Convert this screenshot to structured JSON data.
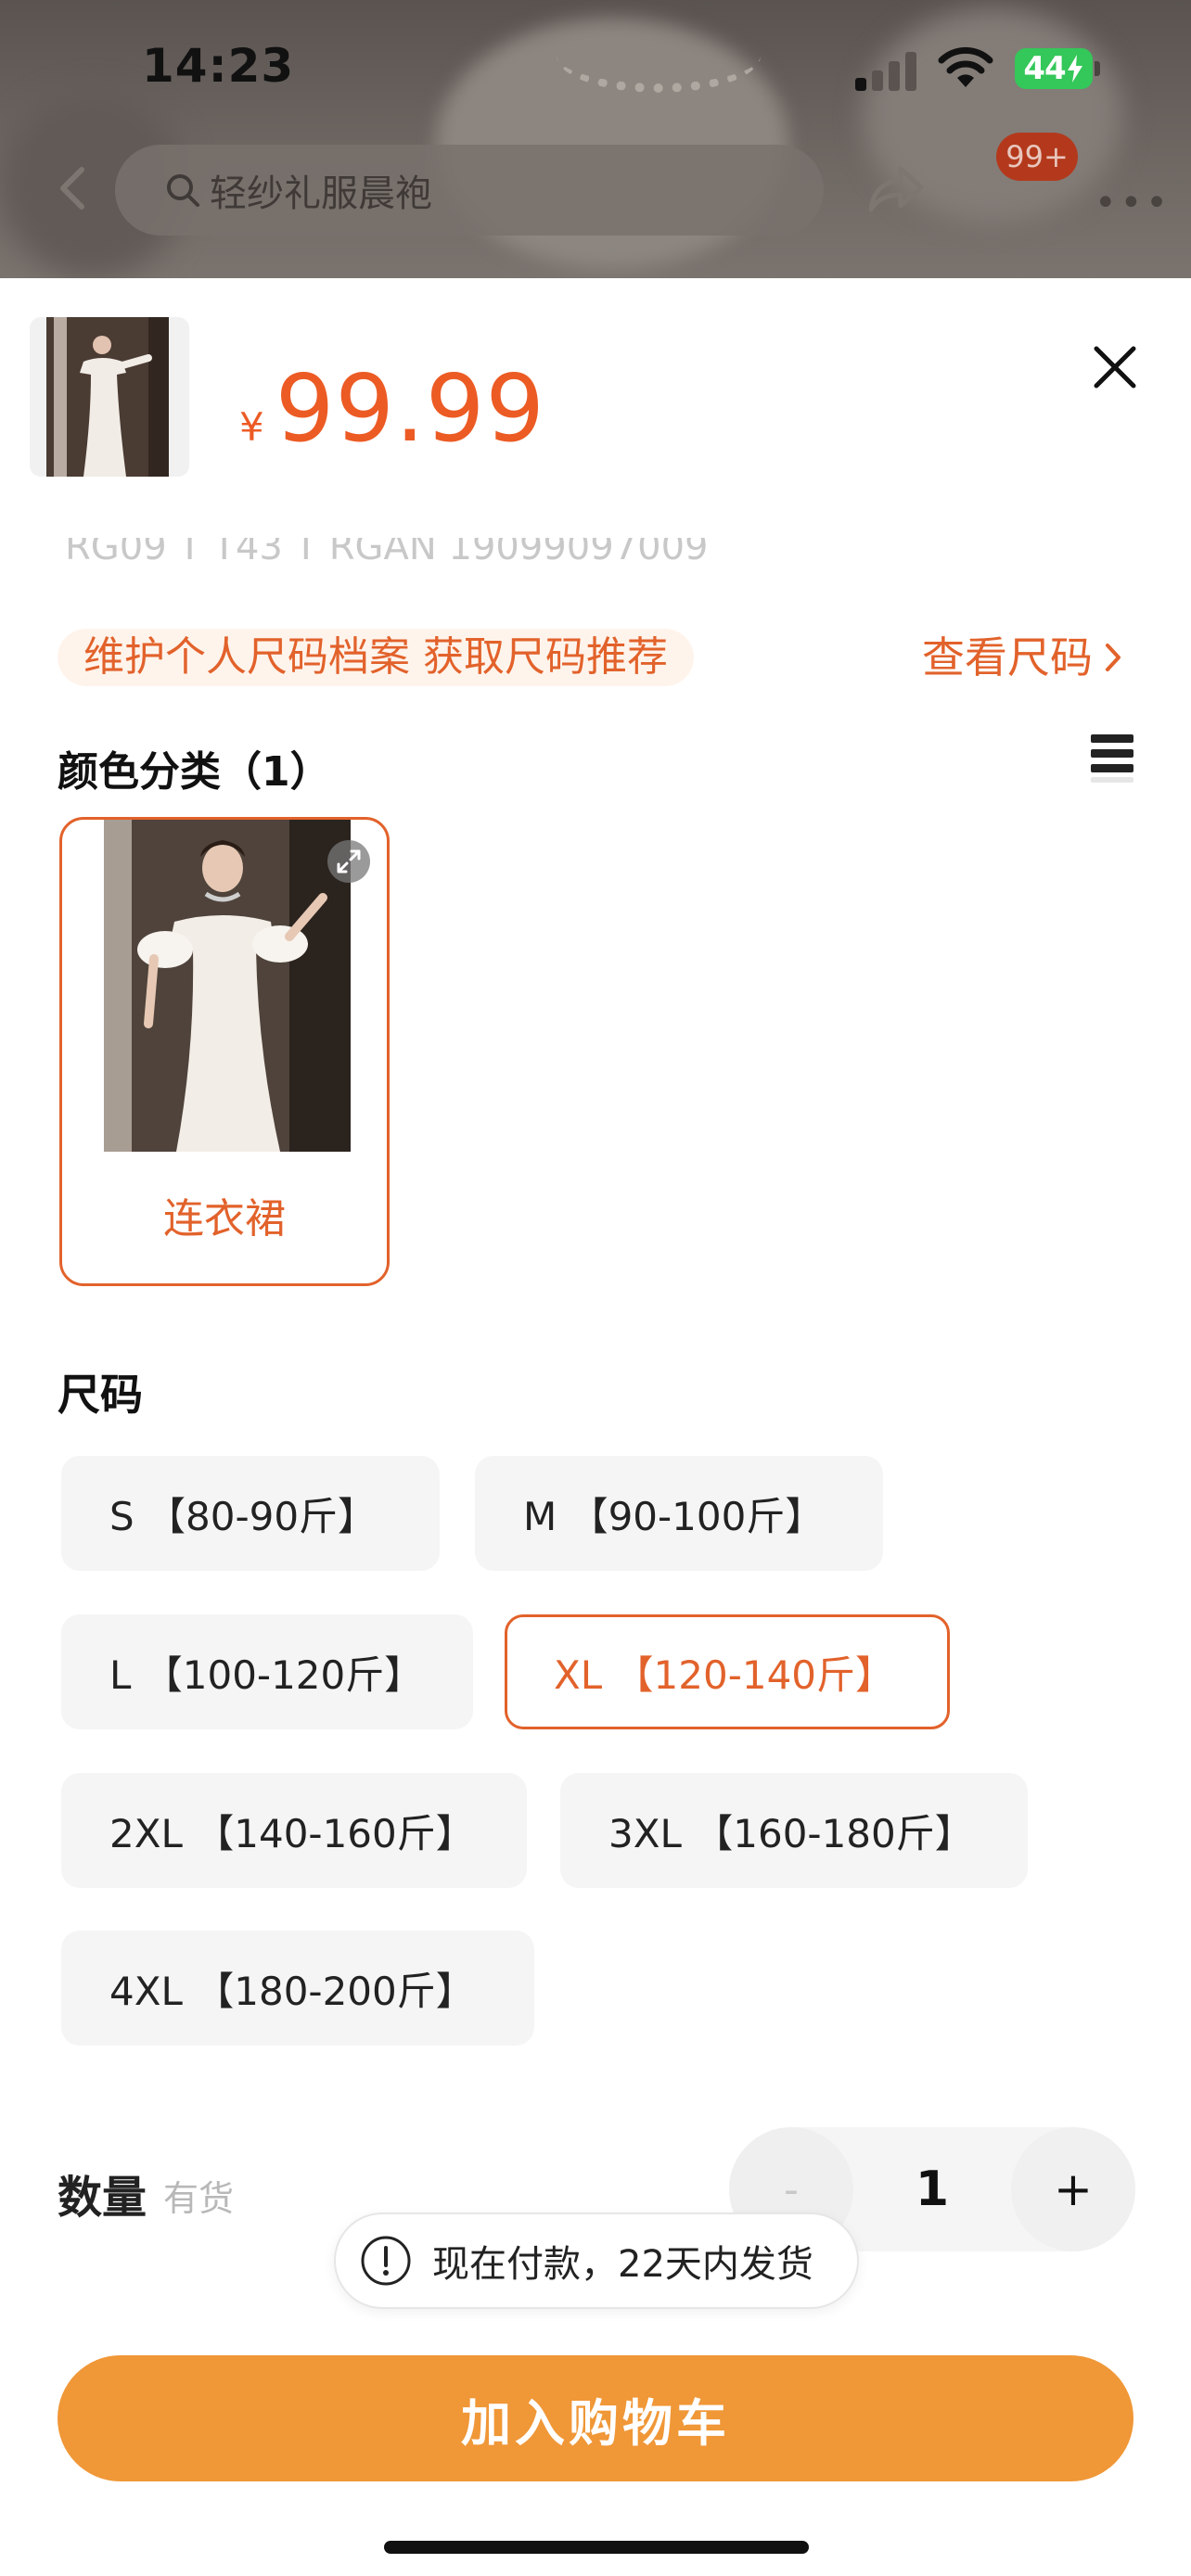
{
  "status_bar": {
    "time": "14:23",
    "battery": "44"
  },
  "header": {
    "search_placeholder": "轻纱礼服晨袍",
    "cart_badge": "99+",
    "more": "•••"
  },
  "product": {
    "currency_symbol": "¥",
    "price": "99.99",
    "sku_code_partial": "RG09 T T43 T RGAN 19099097009"
  },
  "size_profile": {
    "banner_text": "维护个人尺码档案 获取尺码推荐",
    "view_size_label": "查看尺码"
  },
  "color_section": {
    "title": "颜色分类（1）",
    "options": [
      {
        "label": "连衣裙",
        "selected": true
      }
    ]
  },
  "size_section": {
    "title": "尺码",
    "options": [
      {
        "label": "S 【80-90斤】",
        "selected": false
      },
      {
        "label": "M 【90-100斤】",
        "selected": false
      },
      {
        "label": "L 【100-120斤】",
        "selected": false
      },
      {
        "label": "XL 【120-140斤】",
        "selected": true
      },
      {
        "label": "2XL 【140-160斤】",
        "selected": false
      },
      {
        "label": "3XL 【160-180斤】",
        "selected": false
      },
      {
        "label": "4XL 【180-200斤】",
        "selected": false
      }
    ]
  },
  "quantity": {
    "label": "数量",
    "stock": "有货",
    "value": "1",
    "minus": "-",
    "plus": "+"
  },
  "shipping_notice": "现在付款，22天内发货",
  "add_to_cart_label": "加入购物车",
  "colors": {
    "accent": "#e2622b",
    "price": "#ec5b24",
    "cta": "#f09737",
    "battery": "#34c759"
  }
}
